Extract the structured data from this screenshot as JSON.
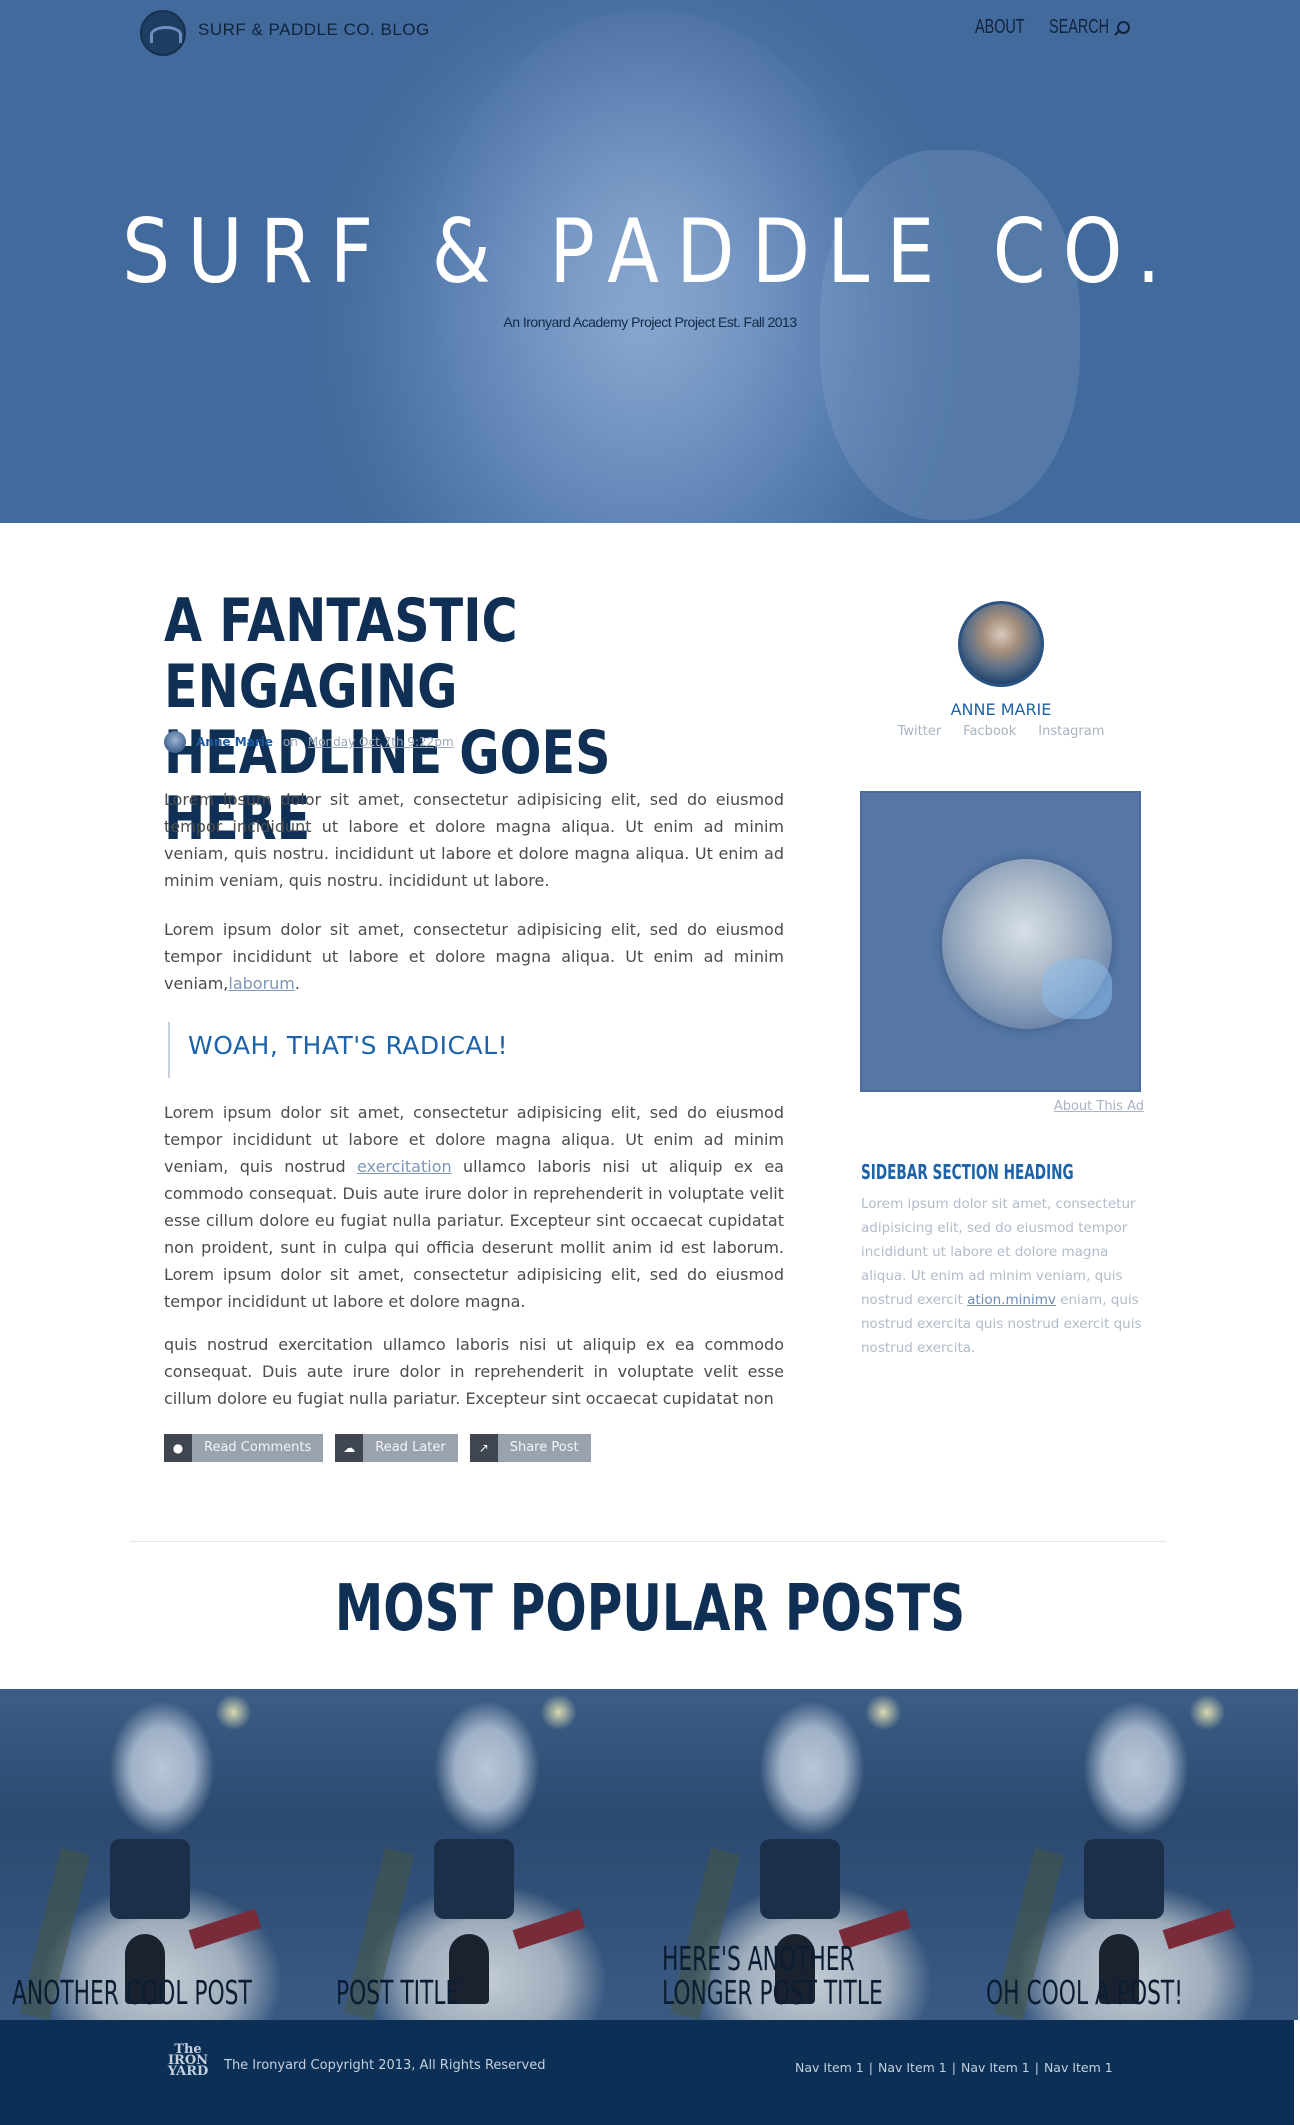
{
  "header": {
    "brand": "SURF & PADDLE CO. BLOG",
    "nav": [
      "ABOUT",
      "SEARCH"
    ]
  },
  "hero": {
    "title": "SURF & PADDLE CO.",
    "subtitle": "An Ironyard Academy Project Project Est. Fall 2013"
  },
  "article": {
    "headline_line1": "A FANTASTIC ENGAGING",
    "headline_line2": "HEADLINE GOES HERE",
    "author": "Anne Marie",
    "on": "on",
    "date": "Monday Oct 7th 9:22pm",
    "p1": "Lorem ipsum dolor sit amet, consectetur adipisicing elit, sed do eiusmod tempor incididunt ut labore et dolore magna aliqua. Ut enim ad minim veniam, quis nostru. incididunt ut labore et dolore magna aliqua. Ut enim ad minim veniam, quis nostru. incididunt ut labore.",
    "p2_text": "Lorem ipsum dolor sit amet, consectetur adipisicing elit, sed do eiusmod tempor incididunt ut labore et dolore magna aliqua. Ut enim ad minim veniam,",
    "p2_link": "laborum",
    "p2_end": ".",
    "pullquote": "WOAH, THAT'S RADICAL!",
    "p3_start": "Lorem ipsum dolor sit amet, consectetur adipisicing elit, sed do eiusmod tempor incididunt ut labore et dolore magna aliqua. Ut enim ad minim veniam, quis nostrud",
    "p3_link": "exercitation",
    "p3_end": "ullamco laboris nisi ut aliquip ex ea commodo consequat. Duis aute irure dolor in reprehenderit in voluptate velit esse cillum dolore eu fugiat nulla pariatur. Excepteur sint occaecat cupidatat non proident, sunt in culpa qui officia deserunt mollit anim id est laborum. Lorem ipsum dolor sit amet, consectetur adipisicing elit, sed do eiusmod tempor incididunt ut labore et dolore magna.",
    "p4": "quis nostrud exercitation ullamco laboris nisi ut aliquip ex ea commodo consequat. Duis aute irure dolor in reprehenderit in voluptate velit esse cillum dolore eu fugiat nulla pariatur. Excepteur sint occaecat cupidatat non",
    "actions": [
      {
        "label": "Read  Comments",
        "icon": "comment-icon"
      },
      {
        "label": "Read  Later",
        "icon": "cloud-download-icon"
      },
      {
        "label": "Share  Post",
        "icon": "share-icon"
      }
    ]
  },
  "sidebar": {
    "name": "ANNE MARIE",
    "social": [
      "Twitter",
      "Facbook",
      "Instagram"
    ],
    "about_ad": "About This Ad",
    "heading": "SIDEBAR SECTION HEADING",
    "text_start": "Lorem ipsum dolor sit amet, consectetur adipisicing elit, sed do eiusmod tempor incididunt ut labore et dolore magna aliqua. Ut enim ad minim veniam, quis nostrud exercit",
    "text_link": "ation.minimv",
    "text_end": "eniam, quis nostrud exercita quis nostrud exercit quis nostrud exercita."
  },
  "popular": {
    "title": "MOST POPULAR POSTS",
    "posts": [
      "ANOTHER COOL POST",
      "POST TITLE",
      "HERE'S ANOTHER\nLONGER POST TITLE",
      "OH COOL A POST!"
    ]
  },
  "footer": {
    "logo_lines": [
      "The",
      "IRON",
      "YARD"
    ],
    "copyright": "The Ironyard Copyright 2013, All Rights Reserved",
    "nav": [
      "Nav Item 1",
      "Nav Item 1",
      "Nav Item 1",
      "Nav Item 1"
    ]
  },
  "colors": {
    "hero_blue": "#5a80b2",
    "navy": "#0f2f54",
    "accent_blue": "#1e62a8",
    "footer_bg": "#0b2f55"
  }
}
